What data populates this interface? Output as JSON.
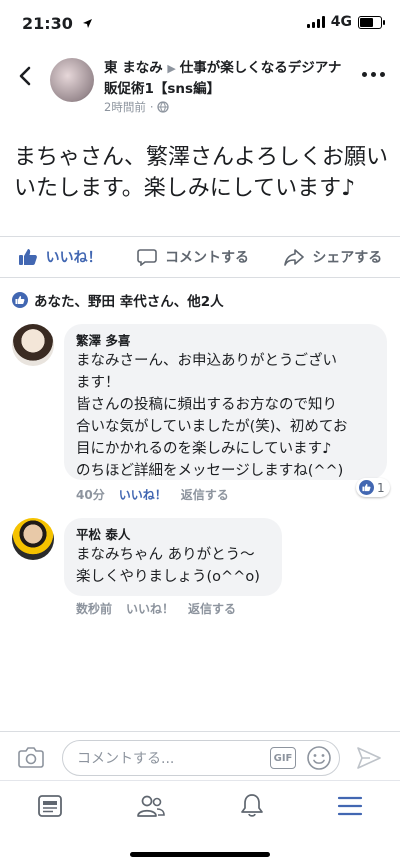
{
  "status": {
    "time": "21:30",
    "network": "4G"
  },
  "header": {
    "author": "東 まなみ",
    "group": "仕事が楽しくなるデジアナ販促術1【sns編】",
    "time": "2時間前"
  },
  "post": {
    "text": "まちゃさん、繁澤さんよろしくお願いいたします。楽しみにしています♪"
  },
  "actions": {
    "like": "いいね！",
    "comment": "コメントする",
    "share": "シェアする"
  },
  "reactions": {
    "summary": "あなた、野田 幸代さん、他2人"
  },
  "comments": [
    {
      "name": "繁澤 多喜",
      "lines": [
        "まなみさーん、お申込ありがとうござい",
        "ます！",
        "皆さんの投稿に頻出するお方なので知り",
        "合いな気がしていましたが(笑)、初めてお",
        "目にかかれるのを楽しみにしています♪",
        "のちほど詳細をメッセージしますね(^^)"
      ],
      "time": "40分",
      "like": "いいね！",
      "reply": "返信する",
      "reaction_count": "1"
    },
    {
      "name": "平松 泰人",
      "lines": [
        "まなみちゃん ありがとう〜",
        "楽しくやりましょう(o^^o)"
      ],
      "time": "数秒前",
      "like": "いいね！",
      "reply": "返信する"
    }
  ],
  "composer": {
    "placeholder": "コメントする...",
    "gif": "GIF"
  },
  "colors": {
    "accent": "#4267b2",
    "bubble": "#f2f3f5",
    "muted": "#8d949e"
  },
  "icons": [
    "back-icon",
    "more-icon",
    "globe-icon",
    "like-icon",
    "comment-icon",
    "share-icon",
    "camera-icon",
    "smiley-icon",
    "send-icon",
    "feed-icon",
    "friends-icon",
    "bell-icon",
    "menu-icon"
  ]
}
